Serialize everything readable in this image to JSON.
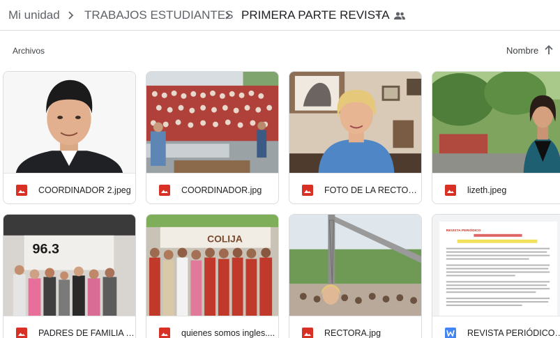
{
  "breadcrumb": {
    "root": "Mi unidad",
    "folder1": "TRABAJOS ESTUDIANTES",
    "current": "PRIMERA PARTE REVISTA"
  },
  "list_header": {
    "section_label": "Archivos",
    "sort_label": "Nombre"
  },
  "files": [
    {
      "name": "COORDINADOR 2.jpeg",
      "type": "image",
      "icon": "image-file-icon"
    },
    {
      "name": "COORDINADOR.jpg",
      "type": "image",
      "icon": "image-file-icon"
    },
    {
      "name": "FOTO DE LA RECTORA...",
      "type": "image",
      "icon": "image-file-icon"
    },
    {
      "name": "lizeth.jpeg",
      "type": "image",
      "icon": "image-file-icon"
    },
    {
      "name": "PADRES DE FAMILIA Y...",
      "type": "image",
      "icon": "image-file-icon"
    },
    {
      "name": "quienes somos ingles....",
      "type": "image",
      "icon": "image-file-icon"
    },
    {
      "name": "RECTORA.jpg",
      "type": "image",
      "icon": "image-file-icon"
    },
    {
      "name": "REVISTA PERIÓDICO p...",
      "type": "word",
      "icon": "word-file-icon"
    }
  ],
  "thumb_text": {
    "radio_logo": "96.3",
    "college_sign": "COLIJA",
    "doc_title": "REVISTA PERIÓDICO"
  },
  "colors": {
    "image_icon": "#d93025",
    "word_icon": "#4285f4",
    "border": "#dadce0"
  }
}
